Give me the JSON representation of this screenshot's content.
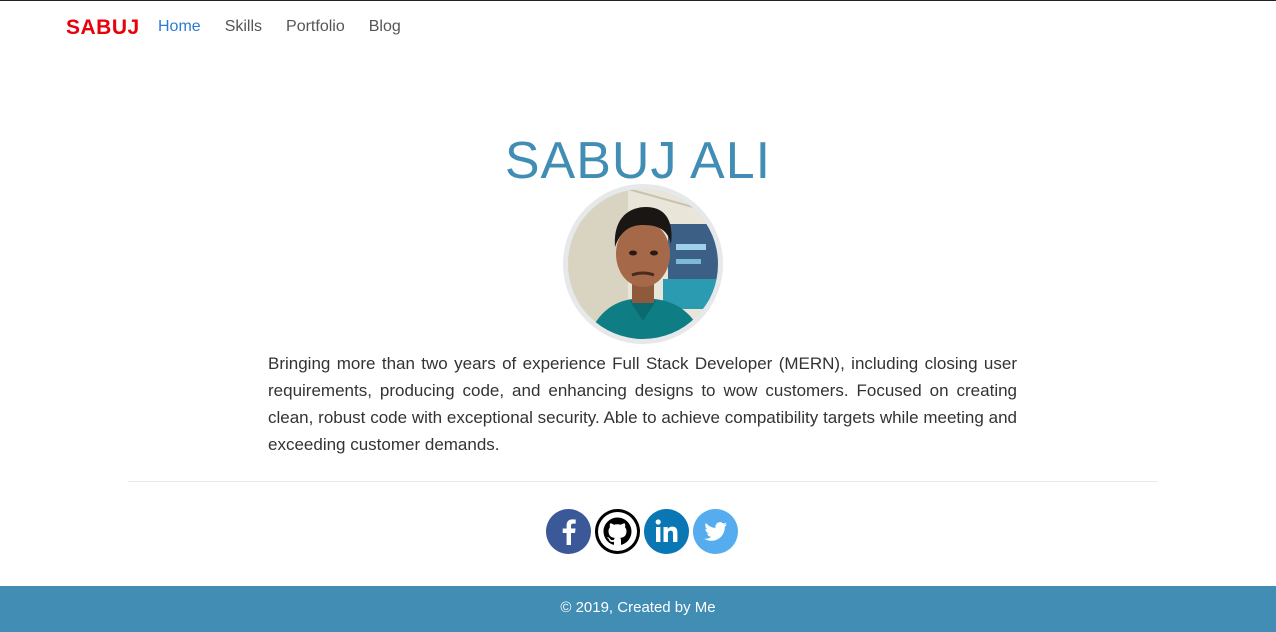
{
  "nav": {
    "brand": "SABUJ",
    "links": [
      "Home",
      "Skills",
      "Portfolio",
      "Blog"
    ],
    "active": "Home"
  },
  "hero": {
    "title": "SABUJ ALI"
  },
  "bio": "Bringing more than two years of experience Full Stack Developer (MERN), including closing user requirements, producing code, and enhancing designs to wow customers. Focused on creating clean, robust code with exceptional security. Able to achieve compatibility targets while meeting and exceeding customer demands.",
  "social": [
    {
      "name": "facebook",
      "icon": "facebook-icon"
    },
    {
      "name": "github",
      "icon": "github-icon"
    },
    {
      "name": "linkedin",
      "icon": "linkedin-icon"
    },
    {
      "name": "twitter",
      "icon": "twitter-icon"
    }
  ],
  "footer": {
    "text": "© 2019, Created by Me"
  },
  "colors": {
    "brand": "#e8000b",
    "accent": "#418db4",
    "nav_active": "#2b7bd2"
  }
}
